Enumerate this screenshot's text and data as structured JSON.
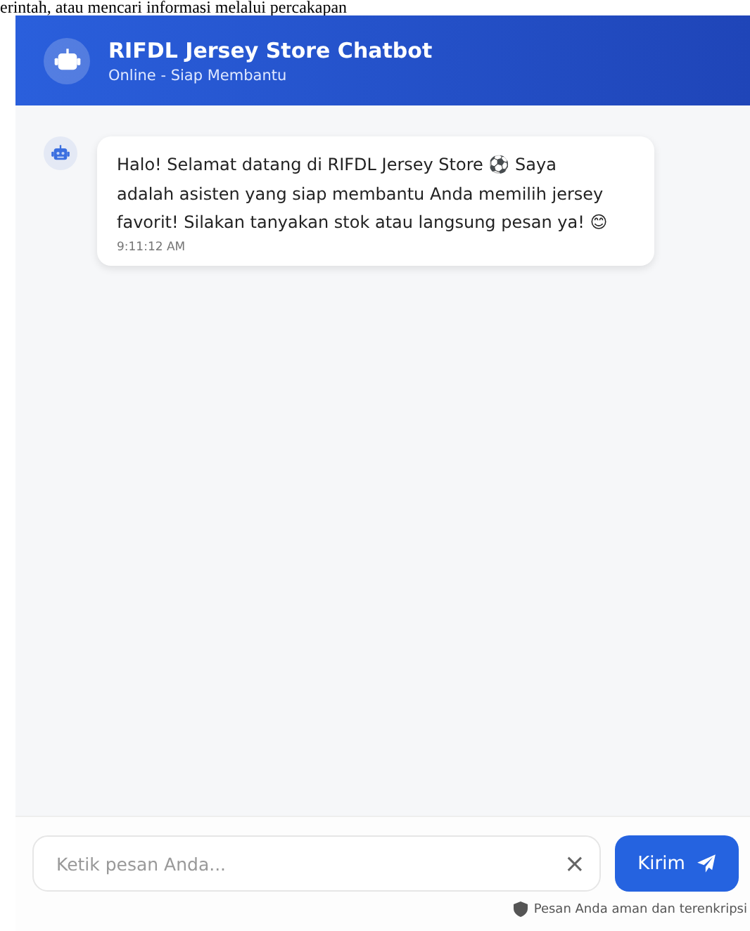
{
  "page_text": "erintah, atau mencari informasi melalui percakapan",
  "header": {
    "title": "RIFDL Jersey Store Chatbot",
    "status": "Online - Siap Membantu"
  },
  "messages": [
    {
      "text": "Halo! Selamat datang di RIFDL Jersey Store ⚽ Saya adalah asisten yang siap membantu Anda memilih jersey favorit! Silakan tanyakan stok atau langsung pesan ya! 😊",
      "time": "9:11:12 AM"
    }
  ],
  "input": {
    "placeholder": "Ketik pesan Anda...",
    "clear": "×"
  },
  "send_button": "Kirim",
  "footer_note": "Pesan Anda aman dan terenkripsi"
}
